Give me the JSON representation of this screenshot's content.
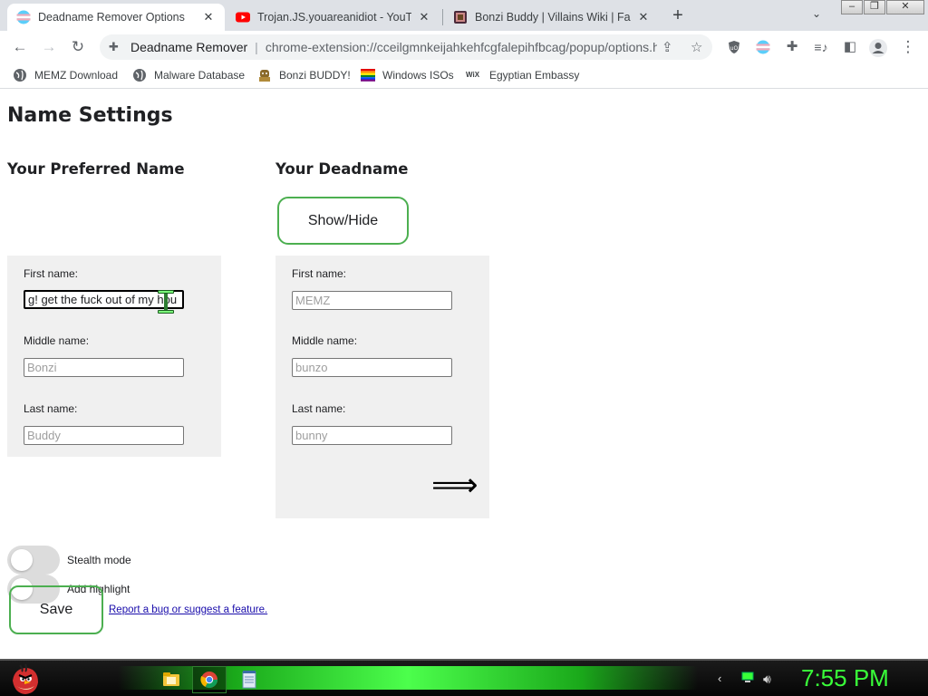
{
  "browser": {
    "tabs": [
      {
        "title": "Deadname Remover Options",
        "favicon": "trans-flag-icon",
        "active": true
      },
      {
        "title": "Trojan.JS.youareanidiot - YouTube",
        "favicon": "youtube-icon",
        "active": false
      },
      {
        "title": "Bonzi Buddy | Villains Wiki | Fandom",
        "favicon": "fandom-icon",
        "active": false
      }
    ],
    "window_buttons": [
      "–",
      "❐",
      "✕"
    ],
    "address": {
      "site_label": "Deadname Remover",
      "url": "chrome-extension://cceilgmnkeijahkehfcgfalepihfbcag/popup/options.html"
    },
    "bookmarks": [
      {
        "label": "MEMZ Download",
        "icon": "globe-icon"
      },
      {
        "label": "Malware Database",
        "icon": "globe-icon"
      },
      {
        "label": "Bonzi BUDDY!",
        "icon": "bonzi-icon"
      },
      {
        "label": "Windows ISOs",
        "icon": "rainbow-flag-icon"
      },
      {
        "label": "Egyptian Embassy",
        "icon": "wix-icon"
      }
    ]
  },
  "page": {
    "title": "Name Settings",
    "preferred": {
      "heading": "Your Preferred Name",
      "first_label": "First name:",
      "first_value": "g! get the fuck out of my hou",
      "middle_label": "Middle name:",
      "middle_placeholder": "Bonzi",
      "last_label": "Last name:",
      "last_placeholder": "Buddy"
    },
    "deadname": {
      "heading": "Your Deadname",
      "show_hide_label": "Show/Hide",
      "first_label": "First name:",
      "first_placeholder": "MEMZ",
      "middle_label": "Middle name:",
      "middle_placeholder": "bunzo",
      "last_label": "Last name:",
      "last_placeholder": "bunny",
      "arrow": "⟹"
    },
    "stealth_label": "Stealth mode",
    "highlight_label": "Add highlight",
    "save_label": "Save",
    "report_link": "Report a bug or suggest a feature."
  },
  "taskbar": {
    "clock": "7:55 PM",
    "accent": "#39ff39"
  }
}
